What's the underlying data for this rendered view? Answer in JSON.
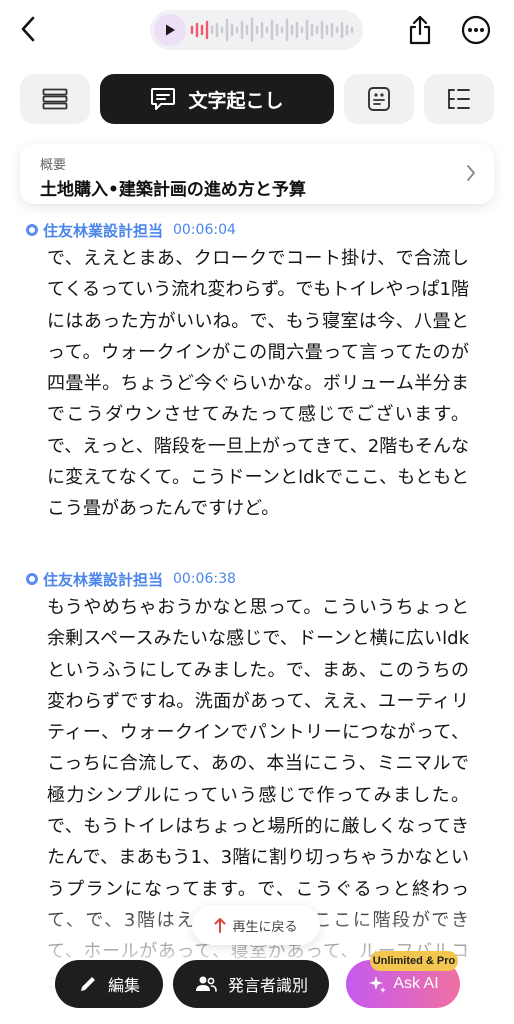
{
  "header": {
    "back_icon": "chevron-left-icon",
    "play_icon": "play-icon",
    "share_icon": "share-icon",
    "more_icon": "ellipsis-circle-icon"
  },
  "tabs": [
    {
      "icon": "list-icon",
      "label": ""
    },
    {
      "icon": "chat-bubble-icon",
      "label": "文字起こし",
      "active": true
    },
    {
      "icon": "note-icon",
      "label": ""
    },
    {
      "icon": "mindmap-icon",
      "label": ""
    }
  ],
  "summary": {
    "kicker": "概要",
    "title": "土地購入•建築計画の進め方と予算"
  },
  "segments": [
    {
      "speaker": "住友林業設計担当",
      "time": "00:06:04",
      "text": "で、ええとまあ、クロークでコート掛け、で合流してくるっていう流れ変わらず。でもトイレやっぱ1階にはあった方がいいね。で、もう寝室は今、八畳とって。ウォークインがこの間六畳って言ってたのが四畳半。ちょうど今ぐらいかな。ボリューム半分までこうダウンさせてみたって感じでございます。で、えっと、階段を一旦上がってきて、2階もそんなに変えてなくて。こうドーンとldkでここ、もともとこう畳があったんですけど。"
    },
    {
      "speaker": "住友林業設計担当",
      "time": "00:06:38",
      "text": "もうやめちゃおうかなと思って。こういうちょっと余剰スペースみたいな感じで、ドーンと横に広いldkというふうにしてみました。で、まあ、このうちの変わらずですね。洗面があって、ええ、ユーティリティー、ウォークインでパントリーにつながって、こっちに合流して、あの、本当にこう、ミニマルで極力シンプルにっていう感じで作ってみました。で、もうトイレはちょっと場所的に厳しくなってきたんで、まあもう1、3階に割り切っちゃうかなというプランになってます。で、こうぐるっと終わって、で、3階はええと。まあ、ここに階段ができて、ホールがあって、寝室があって、ルーフバルコニーがあって、こう畳が"
    }
  ],
  "bottom": {
    "replay_label": "再生に戻る",
    "edit_label": "編集",
    "speaker_label": "発言者識別",
    "askai_label": "Ask AI",
    "badge_label": "Unlimited & Pro"
  }
}
